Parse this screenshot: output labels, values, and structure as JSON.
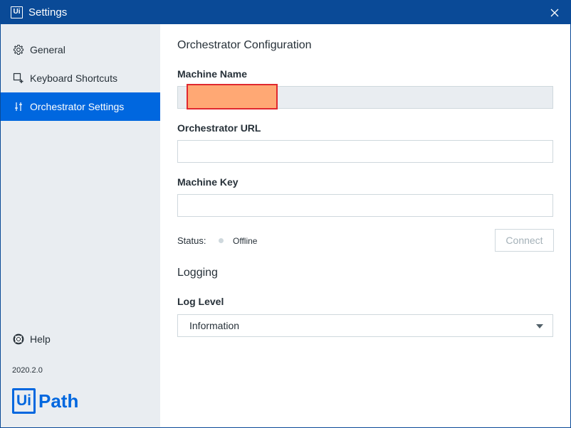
{
  "window": {
    "title": "Settings",
    "app_icon_text": "Ui"
  },
  "sidebar": {
    "items": [
      {
        "label": "General",
        "icon": "gear-icon"
      },
      {
        "label": "Keyboard Shortcuts",
        "icon": "keyboard-shortcut-icon"
      },
      {
        "label": "Orchestrator Settings",
        "icon": "sliders-icon",
        "active": true
      }
    ],
    "help_label": "Help",
    "version": "2020.2.0",
    "logo": {
      "box_text": "Ui",
      "text": "Path"
    }
  },
  "main": {
    "orchestrator_section_title": "Orchestrator Configuration",
    "machine_name": {
      "label": "Machine Name",
      "value": ""
    },
    "orchestrator_url": {
      "label": "Orchestrator URL",
      "value": ""
    },
    "machine_key": {
      "label": "Machine Key",
      "value": ""
    },
    "status": {
      "label": "Status:",
      "value": "Offline"
    },
    "connect_label": "Connect",
    "logging_section_title": "Logging",
    "log_level": {
      "label": "Log Level",
      "selected": "Information"
    }
  },
  "colors": {
    "titlebar": "#0a4a97",
    "accent": "#0067df",
    "sidebar_bg": "#e9edf1",
    "redaction_fill": "#ffa874",
    "redaction_border": "#e0282f"
  }
}
